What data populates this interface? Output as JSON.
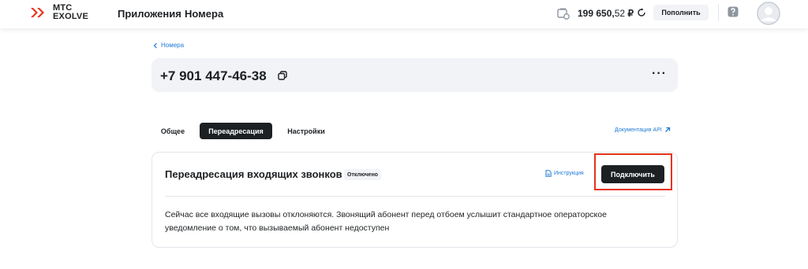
{
  "header": {
    "logo_text_line1": "МТС",
    "logo_text_line2": "EXOLVE",
    "nav": [
      "Приложения",
      "Номера"
    ],
    "balance_main": "199 650,",
    "balance_cents": "52",
    "balance_currency": "₽",
    "topup_label": "Пополнить"
  },
  "breadcrumb": {
    "label": "Номера"
  },
  "number": {
    "value": "+7 901 447-46-38",
    "more_label": "···"
  },
  "tabs": [
    {
      "label": "Общее",
      "active": false
    },
    {
      "label": "Переадресация",
      "active": true
    },
    {
      "label": "Настройки",
      "active": false
    }
  ],
  "api_link": "Документация API",
  "forwarding": {
    "title": "Переадресация входящих звонков",
    "status": "Отключено",
    "guide_label": "Инструкция",
    "connect_label": "Подключить",
    "description": "Сейчас все входящие вызовы отклоняются. Звонящий абонент перед отбоем услышит стандартное операторское уведомление о том, что вызываемый абонент недоступен"
  },
  "colors": {
    "brand_red": "#e5331b",
    "link_blue": "#1e7ad6",
    "dark": "#1d2023",
    "surface": "#f2f3f7"
  }
}
